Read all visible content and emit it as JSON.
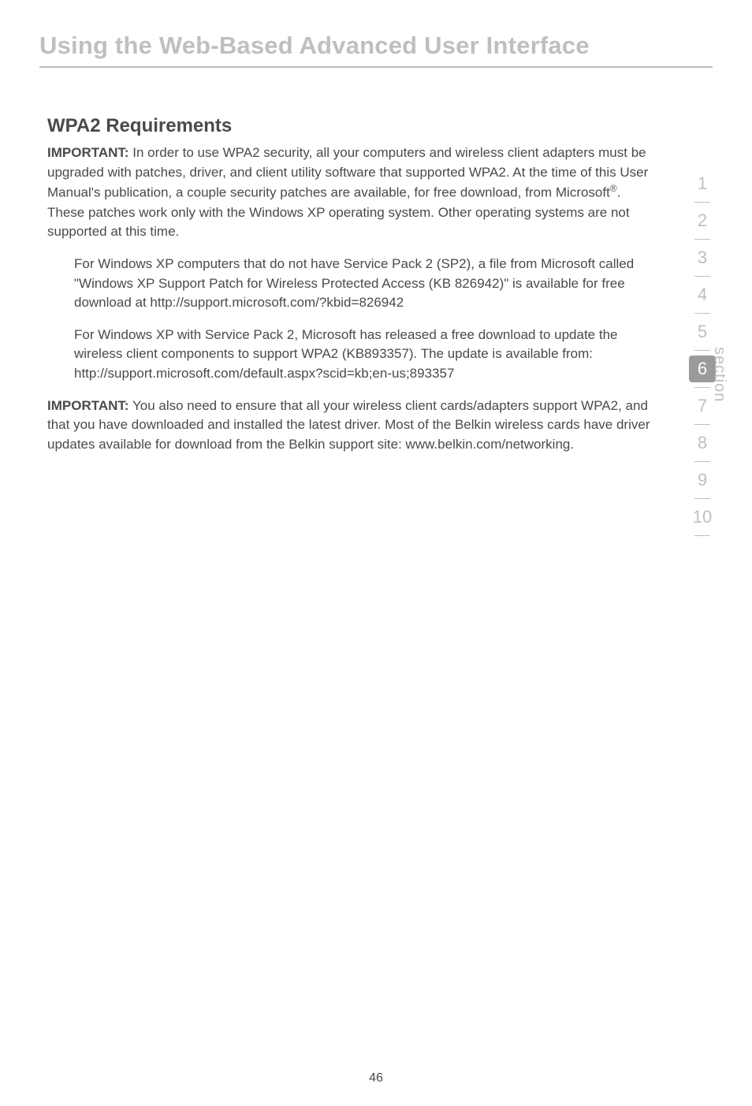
{
  "header": {
    "title": "Using the Web-Based Advanced User Interface"
  },
  "main": {
    "heading": "WPA2 Requirements",
    "p1_label": "IMPORTANT:",
    "p1_text": " In order to use WPA2 security, all your computers and wireless client adapters must be upgraded with patches, driver, and client utility software that supported WPA2. At the time of this User Manual's publication, a couple security patches are available, for free download, from Microsoft",
    "p1_reg": "®",
    "p1_tail": ". These patches work only with the Windows XP operating system. Other operating systems are not supported at this time.",
    "p2": "For Windows XP computers that do not have Service Pack 2 (SP2), a file from Microsoft called \"Windows XP Support Patch for Wireless Protected Access (KB 826942)\" is available for free download at http://support.microsoft.com/?kbid=826942",
    "p3": "For Windows XP with Service Pack 2, Microsoft has released a free download to update the wireless client components to support WPA2 (KB893357). The update is available from: http://support.microsoft.com/default.aspx?scid=kb;en-us;893357",
    "p4_label": "IMPORTANT:",
    "p4_text": " You also need to ensure that all your wireless client cards/adapters support WPA2, and that you have downloaded and installed the latest driver. Most of the Belkin wireless cards have driver updates available for download from the Belkin support site: www.belkin.com/networking."
  },
  "sidenav": {
    "label": "section",
    "items": [
      "1",
      "2",
      "3",
      "4",
      "5",
      "6",
      "7",
      "8",
      "9",
      "10"
    ],
    "active_index": 5
  },
  "footer": {
    "page_number": "46"
  }
}
